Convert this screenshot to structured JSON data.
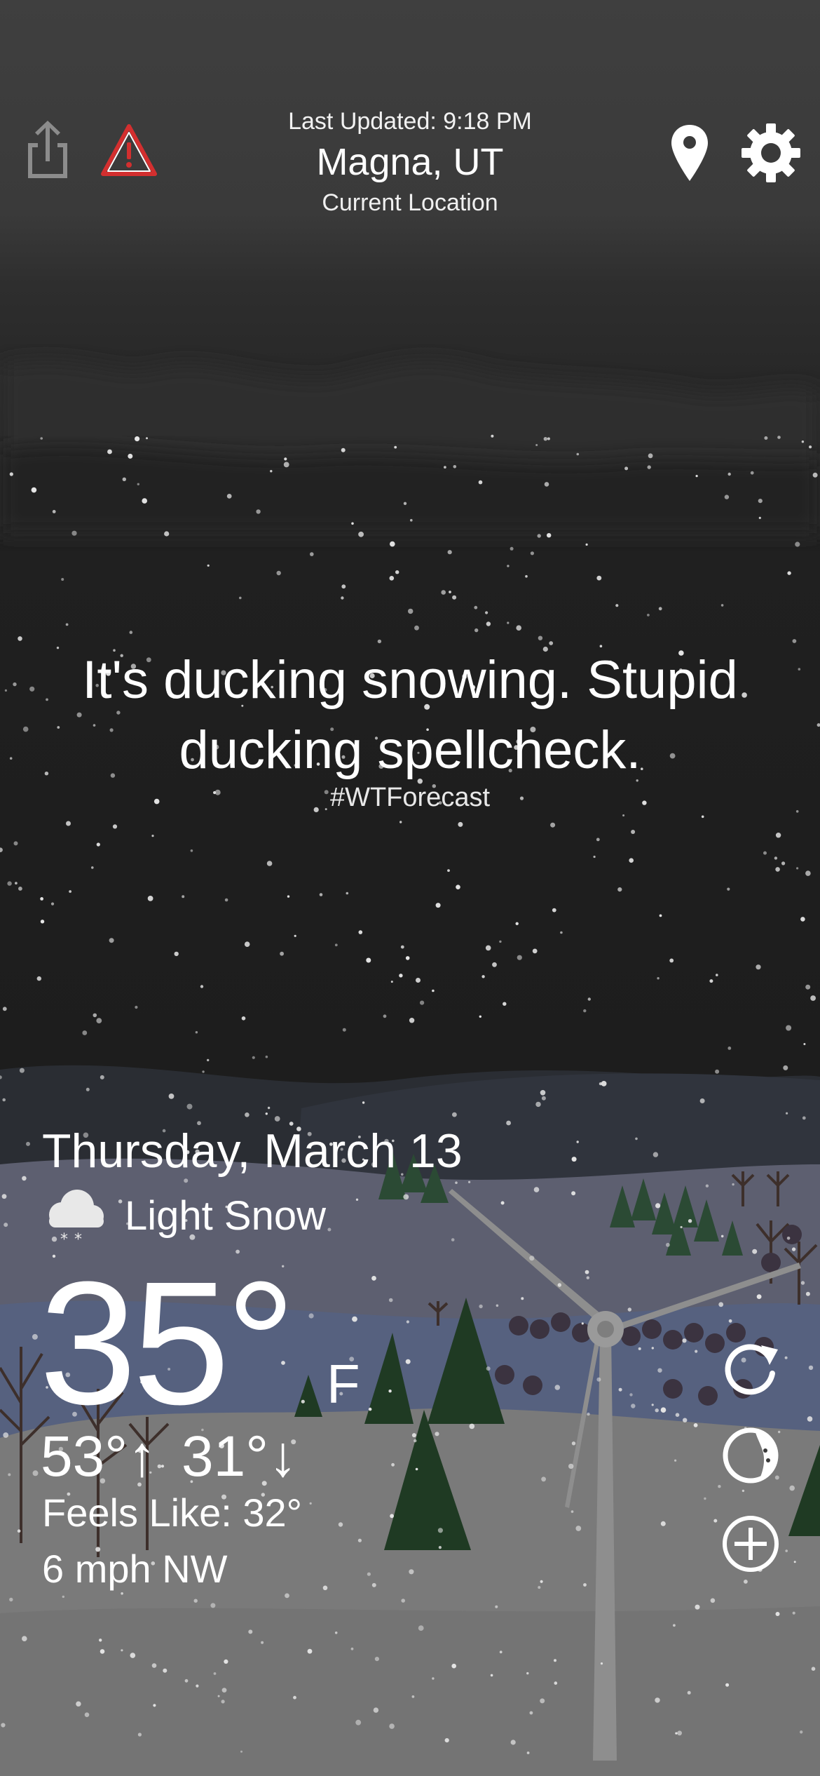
{
  "header": {
    "last_updated": "Last Updated: 9:18 PM",
    "city": "Magna, UT",
    "location_label": "Current Location",
    "icons": [
      "share-icon",
      "alert-icon",
      "location-pin-icon",
      "gear-icon"
    ]
  },
  "headline": {
    "text": "It's ducking snowing. Stupid ducking spellcheck.",
    "hashtag": "#WTForecast"
  },
  "weather": {
    "date": "Thursday, March 13",
    "condition": "Light Snow",
    "condition_icon": "snow-cloud-icon",
    "temperature": "35°",
    "unit": "F",
    "high": "53°",
    "low": "31°",
    "feels_like": "Feels Like: 32°",
    "wind": "6 mph NW"
  },
  "actions": [
    "refresh-icon",
    "radar-icon",
    "add-icon"
  ],
  "colors": {
    "sky_top": "#3d3d3d",
    "sky_mid": "#1e1e1e",
    "alert_red": "#d32f2f",
    "tree_green": "#1f3a23",
    "snow_ground": "#7d7d7d",
    "hill_blue": "#56617f"
  }
}
